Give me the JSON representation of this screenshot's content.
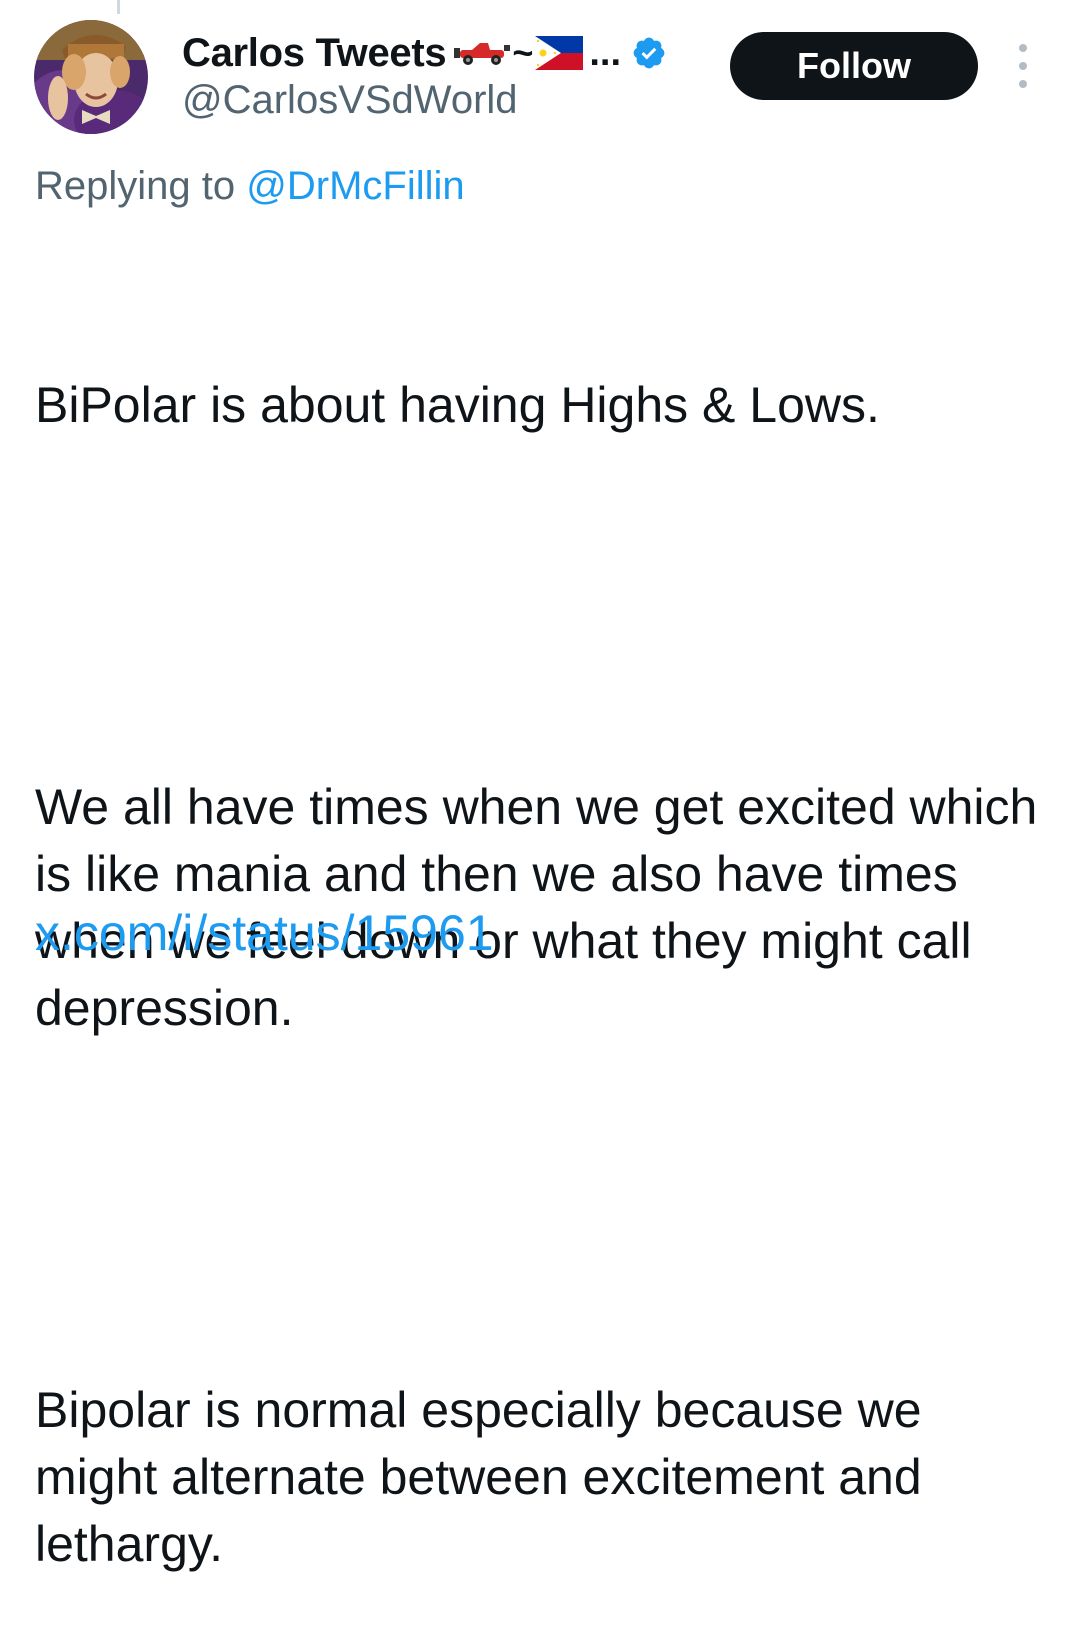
{
  "tweet": {
    "display_name": "Carlos Tweets",
    "name_separator": "~",
    "name_ellipsis": "...",
    "handle": "@CarlosVSdWorld",
    "follow_label": "Follow",
    "replying_prefix": "Replying to",
    "replying_to": "@DrMcFillin",
    "paragraphs": [
      "BiPolar is about having Highs & Lows.",
      "We all have times when we get excited which is like mania and then we also have times when we feel down or what they might call depression.",
      "Bipolar is normal especially because we might alternate between excitement and lethargy."
    ],
    "link_text": "x.com/i/status/15961"
  },
  "icons": {
    "verified": "verified-badge-icon",
    "car": "race-car-emoji-icon",
    "flag": "philippines-flag-emoji-icon",
    "more": "more-options-icon"
  },
  "colors": {
    "accent": "#1d9bf0",
    "text": "#0f1419",
    "secondary": "#536471",
    "button_bg": "#0f1419"
  }
}
